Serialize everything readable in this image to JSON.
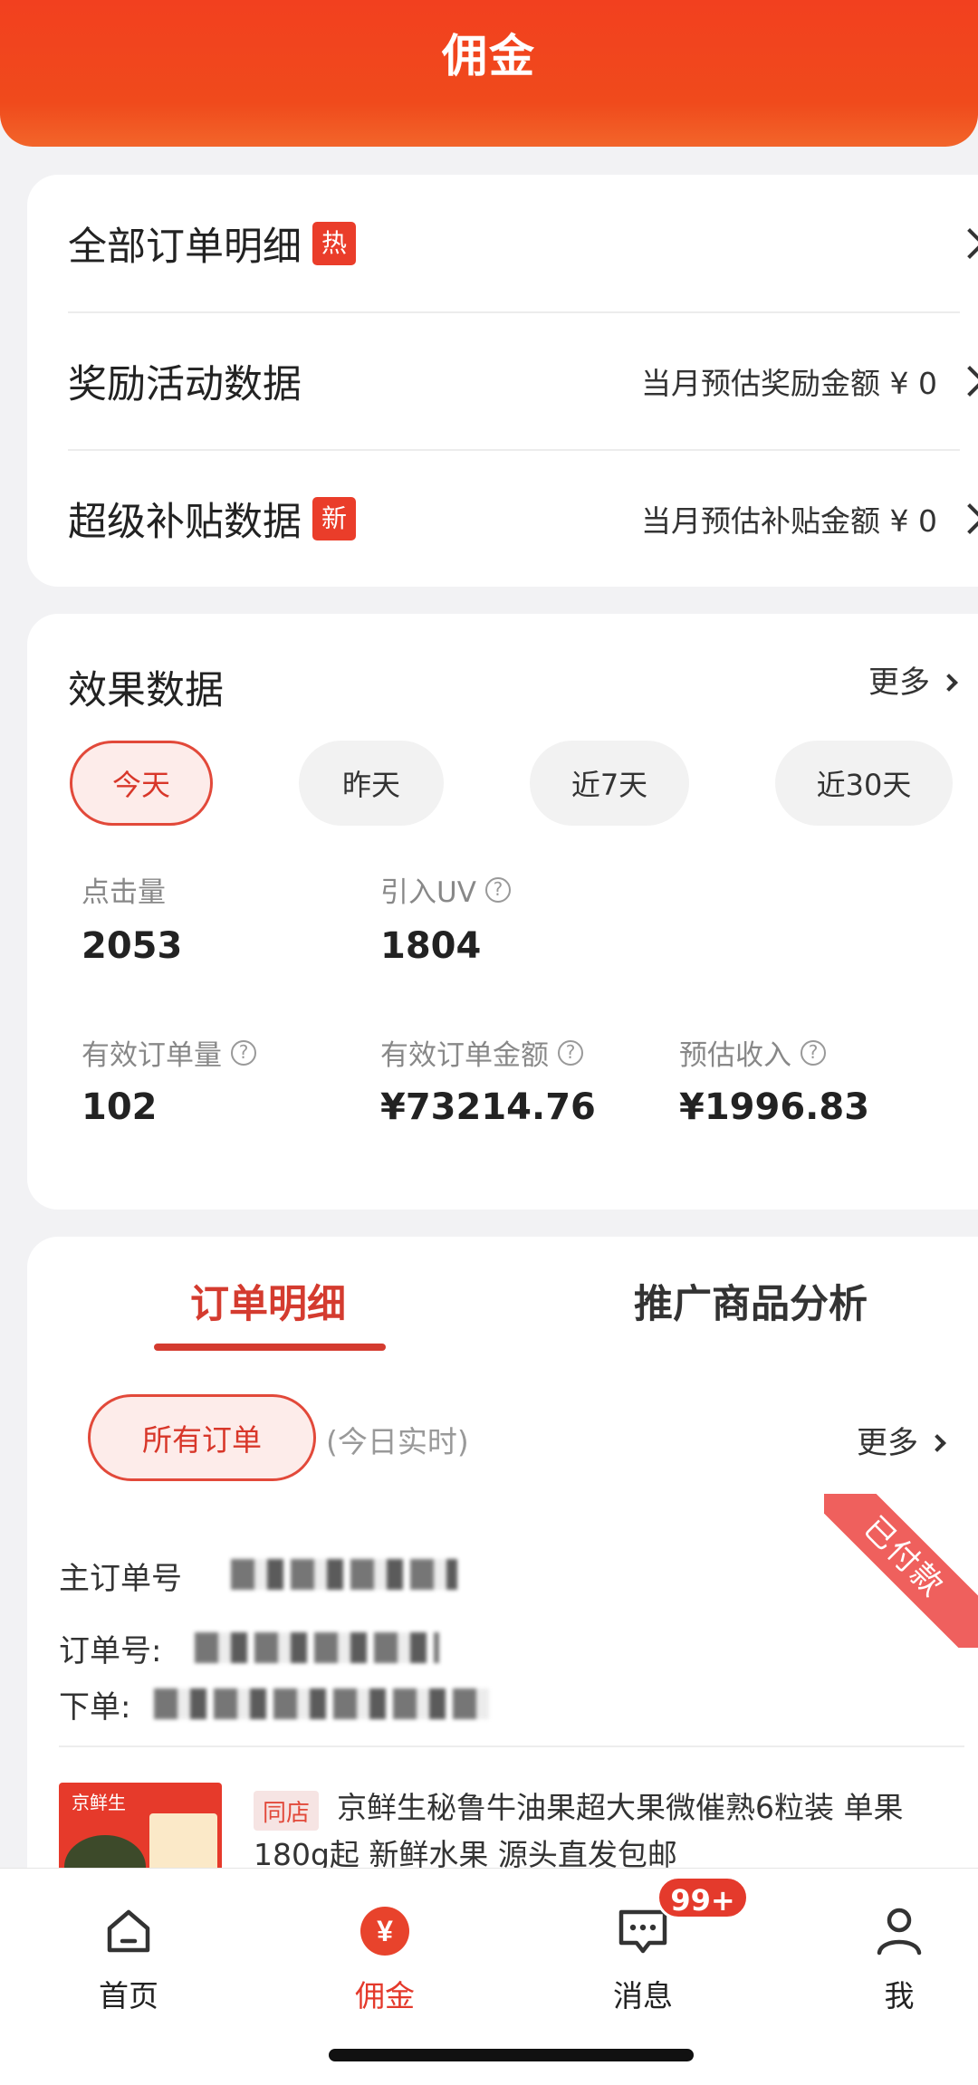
{
  "header": {
    "title": "佣金"
  },
  "menu": {
    "items": [
      {
        "label": "全部订单明细",
        "tag": "热",
        "right": ""
      },
      {
        "label": "奖励活动数据",
        "tag": "",
        "right": "当月预估奖励金额 ¥ 0"
      },
      {
        "label": "超级补贴数据",
        "tag": "新",
        "right": "当月预估补贴金额 ¥ 0"
      }
    ]
  },
  "effect": {
    "title": "效果数据",
    "more": "更多",
    "filters": [
      {
        "label": "今天",
        "active": true
      },
      {
        "label": "昨天",
        "active": false
      },
      {
        "label": "近7天",
        "active": false
      },
      {
        "label": "近30天",
        "active": false
      }
    ],
    "metrics": [
      {
        "label": "点击量",
        "value": "2053",
        "help": false
      },
      {
        "label": "引入UV",
        "value": "1804",
        "help": true
      },
      {
        "label": "有效订单量",
        "value": "102",
        "help": true
      },
      {
        "label": "有效订单金额",
        "value": "¥73214.76",
        "help": true
      },
      {
        "label": "预估收入",
        "value": "¥1996.83",
        "help": true
      }
    ]
  },
  "orders": {
    "tabs": [
      {
        "label": "订单明细",
        "active": true
      },
      {
        "label": "推广商品分析",
        "active": false
      }
    ],
    "filter_label": "所有订单",
    "realtime_note": "(今日实时)",
    "more": "更多",
    "status_ribbon": "已付款",
    "main_order_label": "主订单号",
    "order_no_label": "订单号:",
    "placed_label": "下单:",
    "product": {
      "image_brand": "京鲜生",
      "store_tag": "同店",
      "title": "京鲜生秘鲁牛油果超大果微催熟6粒装 单果180g起 新鲜水果 源头直发包邮"
    }
  },
  "nav": {
    "items": [
      {
        "label": "首页",
        "icon": "home-icon",
        "active": false
      },
      {
        "label": "佣金",
        "icon": "yen-icon",
        "active": true
      },
      {
        "label": "消息",
        "icon": "message-icon",
        "active": false
      },
      {
        "label": "我",
        "icon": "user-icon",
        "active": false
      }
    ],
    "message_badge": "99+"
  },
  "colors": {
    "accent": "#e4392b",
    "header": "#f2401f"
  }
}
